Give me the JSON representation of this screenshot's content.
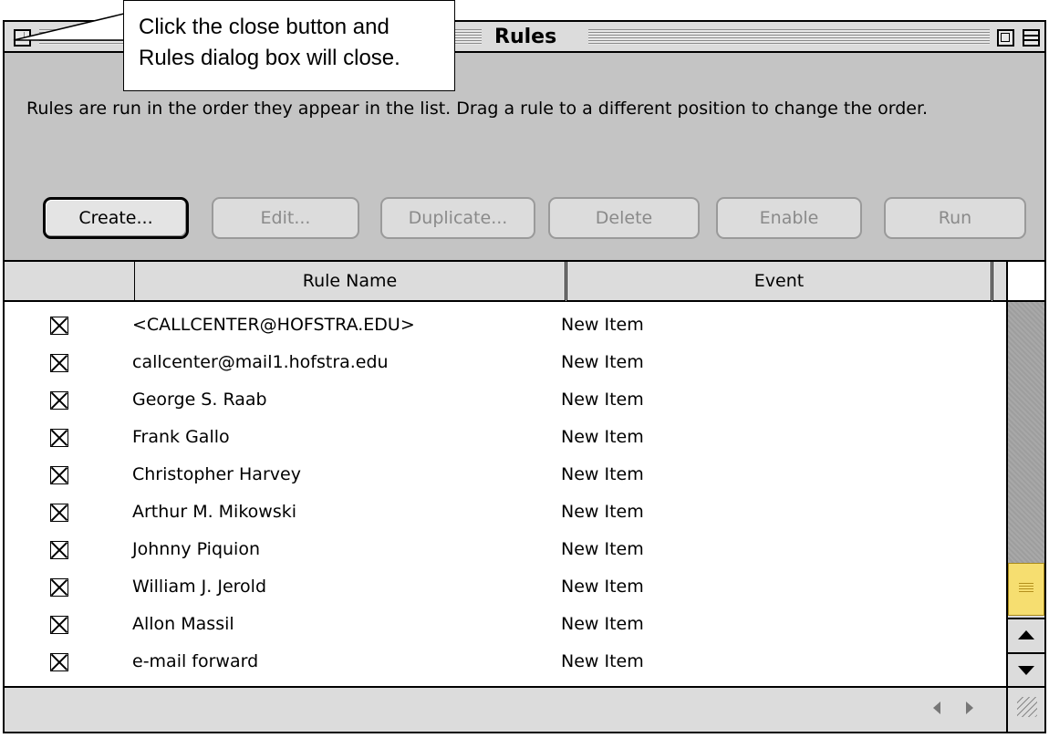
{
  "window": {
    "title": "Rules"
  },
  "callout": {
    "line1": "Click the close button and",
    "line2": "Rules dialog box will close."
  },
  "instructions": {
    "text": "Rules are run in the order they appear in the list.  Drag a rule to a different position to change the order."
  },
  "toolbar": {
    "create_label": "Create...",
    "edit_label": "Edit...",
    "duplicate_label": "Duplicate...",
    "delete_label": "Delete",
    "enable_label": "Enable",
    "run_label": "Run"
  },
  "table": {
    "headers": {
      "rule_name": "Rule Name",
      "event": "Event"
    },
    "rows": [
      {
        "name": "<CALLCENTER@HOFSTRA.EDU>",
        "event": "New Item",
        "enabled": true
      },
      {
        "name": "callcenter@mail1.hofstra.edu",
        "event": "New Item",
        "enabled": true
      },
      {
        "name": "George S. Raab",
        "event": "New Item",
        "enabled": true
      },
      {
        "name": "Frank Gallo",
        "event": "New Item",
        "enabled": true
      },
      {
        "name": "Christopher Harvey",
        "event": "New Item",
        "enabled": true
      },
      {
        "name": "Arthur M. Mikowski",
        "event": "New Item",
        "enabled": true
      },
      {
        "name": "Johnny Piquion",
        "event": "New Item",
        "enabled": true
      },
      {
        "name": "William J. Jerold",
        "event": "New Item",
        "enabled": true
      },
      {
        "name": "Allon Massil",
        "event": "New Item",
        "enabled": true
      },
      {
        "name": "e-mail forward",
        "event": "New Item",
        "enabled": true
      }
    ]
  },
  "colors": {
    "window_bg": "#c4c4c4",
    "scroll_thumb": "#f6de70"
  },
  "icons": {
    "close": "close-box-icon",
    "zoom": "zoom-box-icon",
    "collapse": "collapse-box-icon",
    "checkbox": "checked-box-icon",
    "grow": "resize-grip-icon"
  }
}
